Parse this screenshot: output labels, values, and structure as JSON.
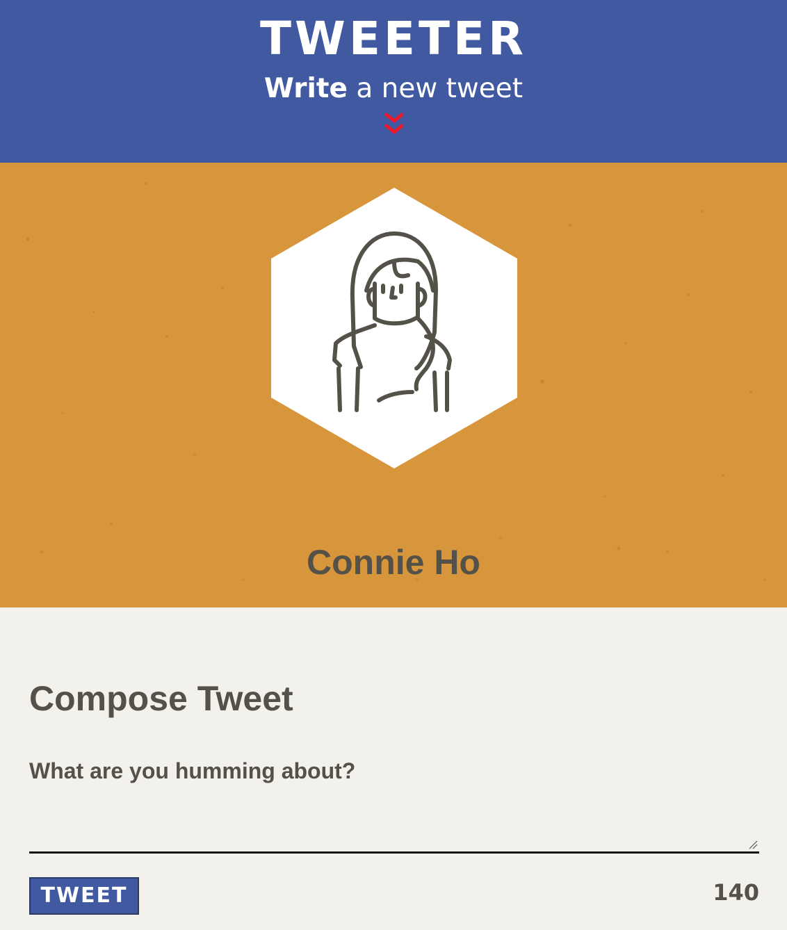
{
  "header": {
    "brand": "TWEETER",
    "new_tweet_strong": "Write",
    "new_tweet_rest": " a new tweet",
    "toggle_icon": "double-chevron-down-icon",
    "colors": {
      "background": "#4059a0",
      "chevron": "#e8192c"
    }
  },
  "profile": {
    "name": "Connie Ho",
    "avatar_icon": "woman-avatar-icon",
    "colors": {
      "background": "#d8963c",
      "hexagon": "#ffffff",
      "avatar_stroke": "#545149"
    }
  },
  "compose": {
    "title": "Compose Tweet",
    "placeholder": "What are you humming about?",
    "value": "",
    "submit_label": "TWEET",
    "counter": "140"
  }
}
